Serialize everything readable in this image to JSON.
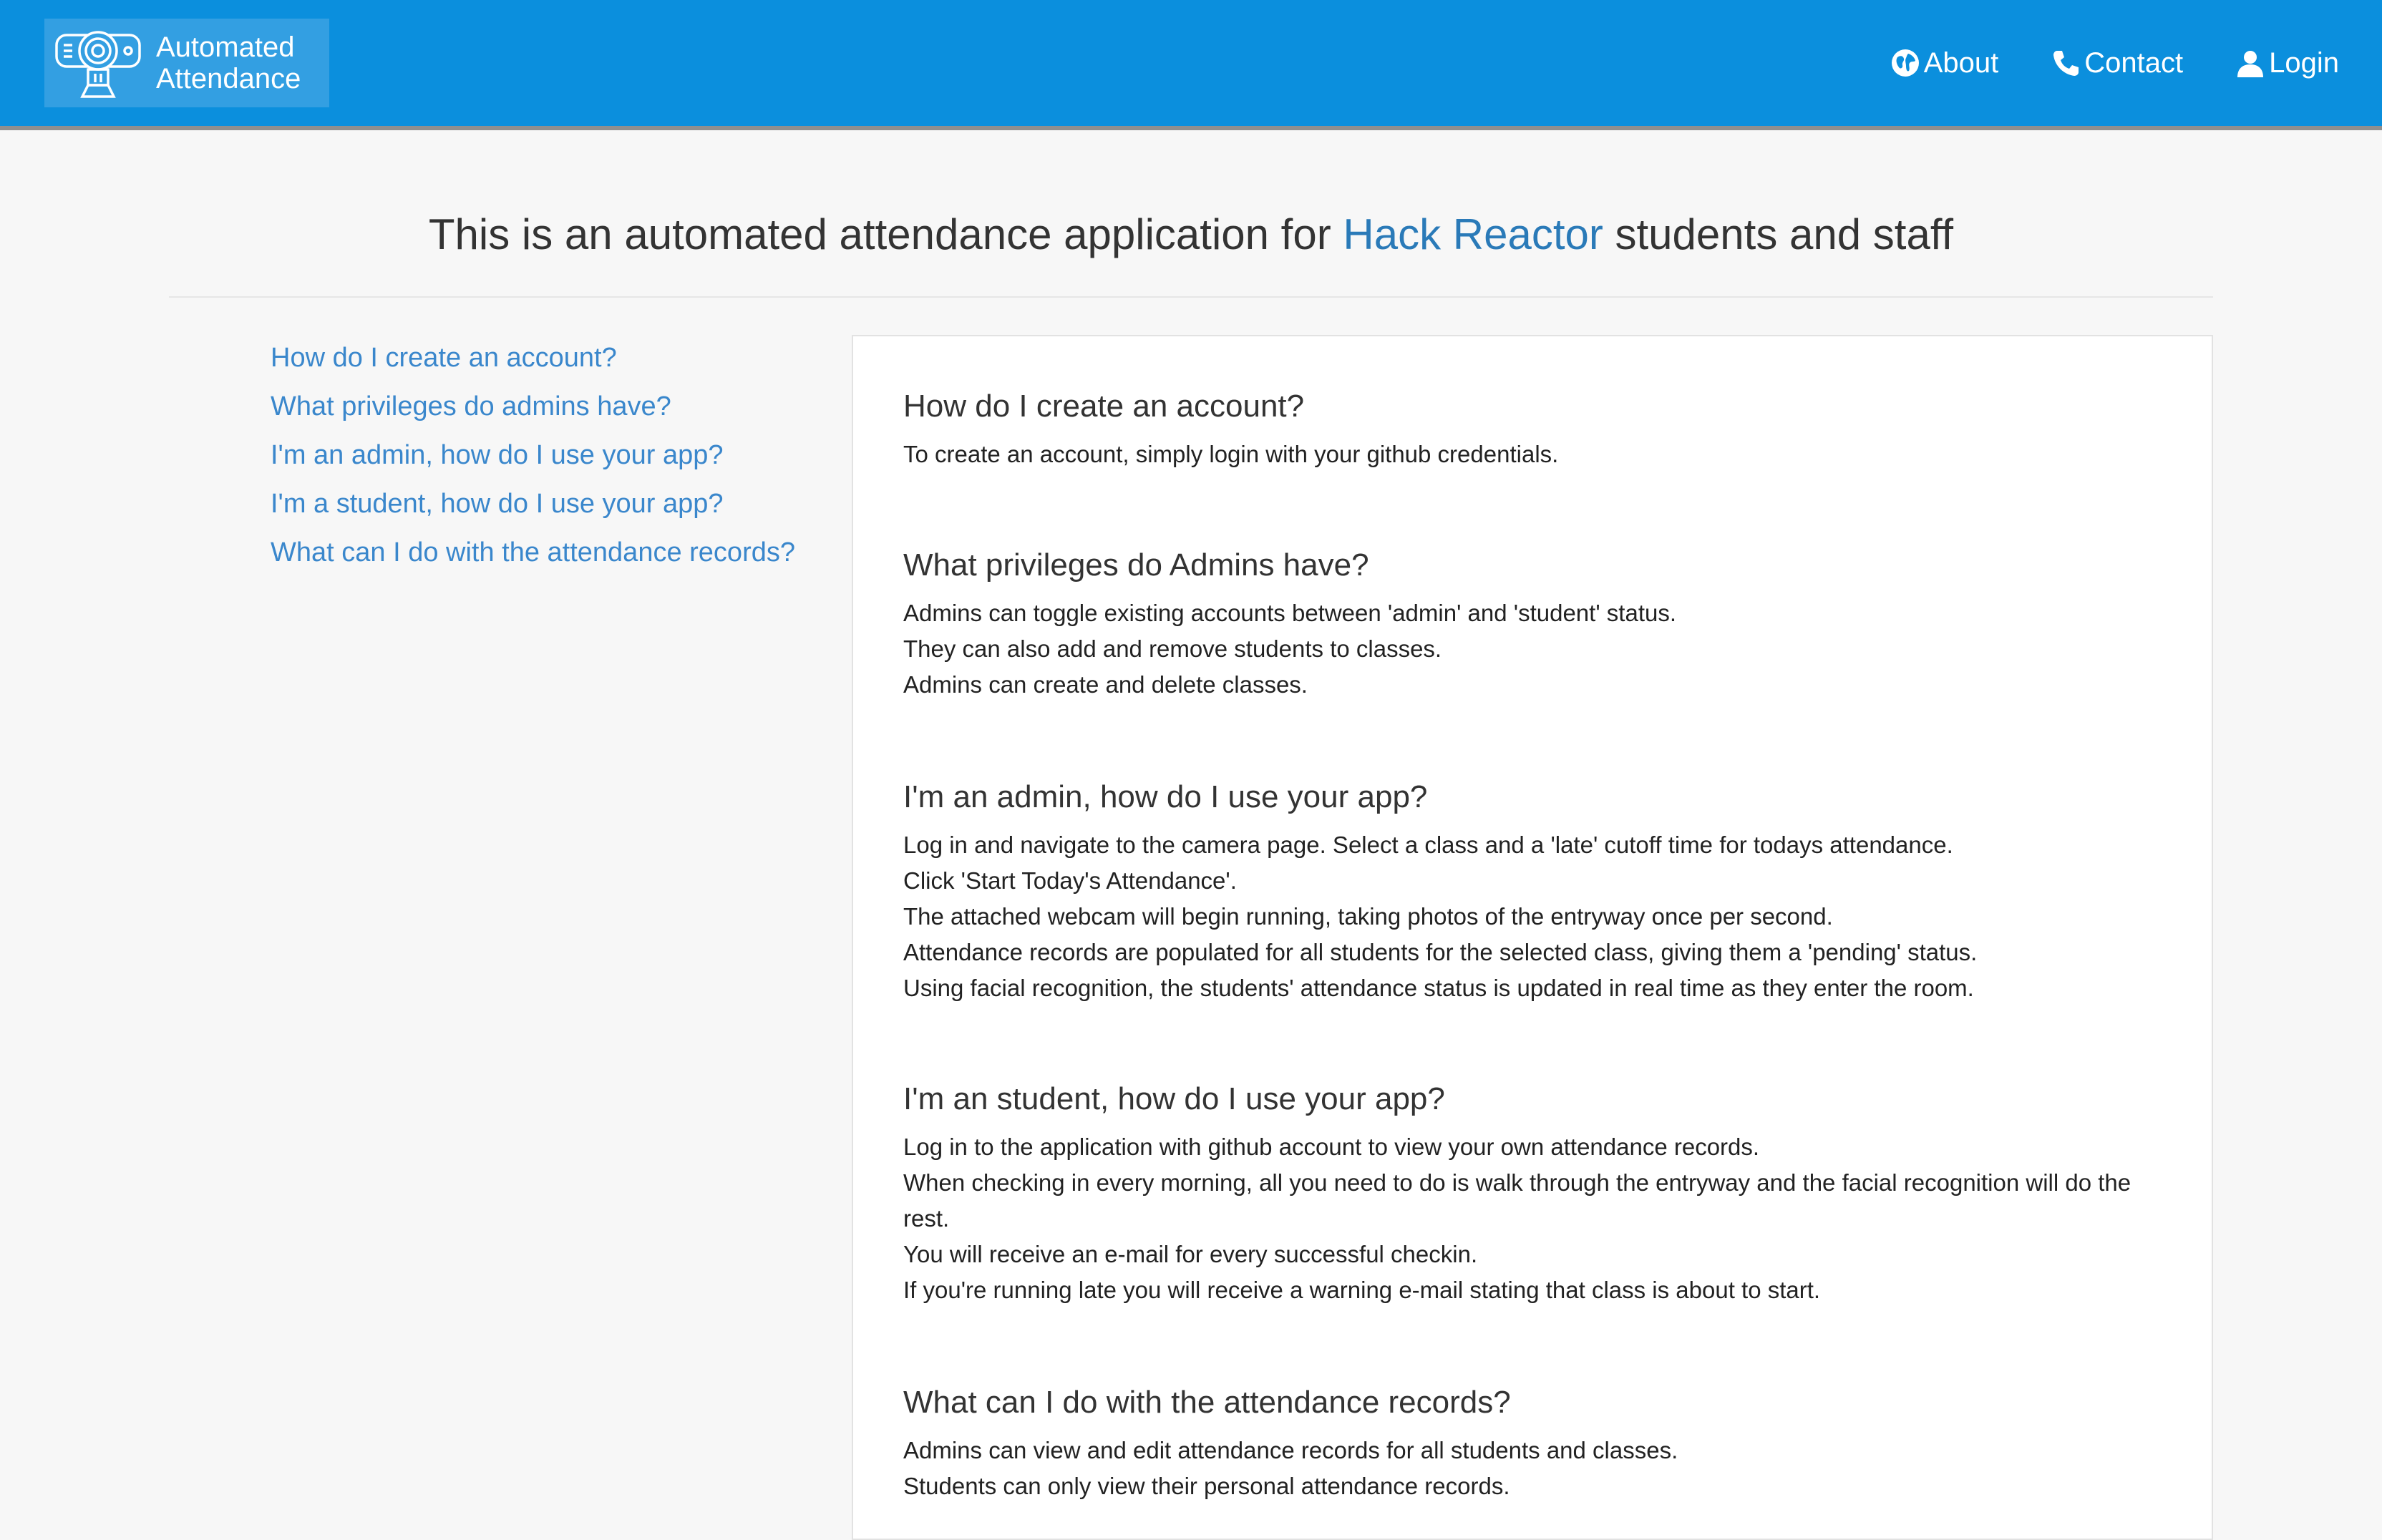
{
  "brand": {
    "line1": "Automated",
    "line2": "Attendance"
  },
  "nav": {
    "about": "About",
    "contact": "Contact",
    "login": "Login"
  },
  "heading": {
    "prefix": "This is an automated attendance application for ",
    "link": "Hack Reactor",
    "suffix": " students and staff"
  },
  "sidebar": {
    "items": [
      {
        "label": "How do I create an account?"
      },
      {
        "label": "What privileges do admins have?"
      },
      {
        "label": "I'm an admin, how do I use your app?"
      },
      {
        "label": "I'm a student, how do I use your app?"
      },
      {
        "label": "What can I do with the attendance records?"
      }
    ]
  },
  "faqs": [
    {
      "title": "How do I create an account?",
      "lines": [
        "To create an account, simply login with your github credentials."
      ]
    },
    {
      "title": "What privileges do Admins have?",
      "lines": [
        "Admins can toggle existing accounts between 'admin' and 'student' status.",
        "They can also add and remove students to classes.",
        "Admins can create and delete classes."
      ]
    },
    {
      "title": "I'm an admin, how do I use your app?",
      "lines": [
        "Log in and navigate to the camera page. Select a class and a 'late' cutoff time for todays attendance.",
        "Click 'Start Today's Attendance'.",
        "The attached webcam will begin running, taking photos of the entryway once per second.",
        "Attendance records are populated for all students for the selected class, giving them a 'pending' status.",
        "Using facial recognition, the students' attendance status is updated in real time as they enter the room."
      ]
    },
    {
      "title": "I'm an student, how do I use your app?",
      "lines": [
        "Log in to the application with github account to view your own attendance records.",
        "When checking in every morning, all you need to do is walk through the entryway and the facial recognition will do the rest.",
        "You will receive an e-mail for every successful checkin.",
        "If you're running late you will receive a warning e-mail stating that class is about to start."
      ]
    },
    {
      "title": "What can I do with the attendance records?",
      "lines": [
        "Admins can view and edit attendance records for all students and classes.",
        "Students can only view their personal attendance records."
      ]
    }
  ]
}
